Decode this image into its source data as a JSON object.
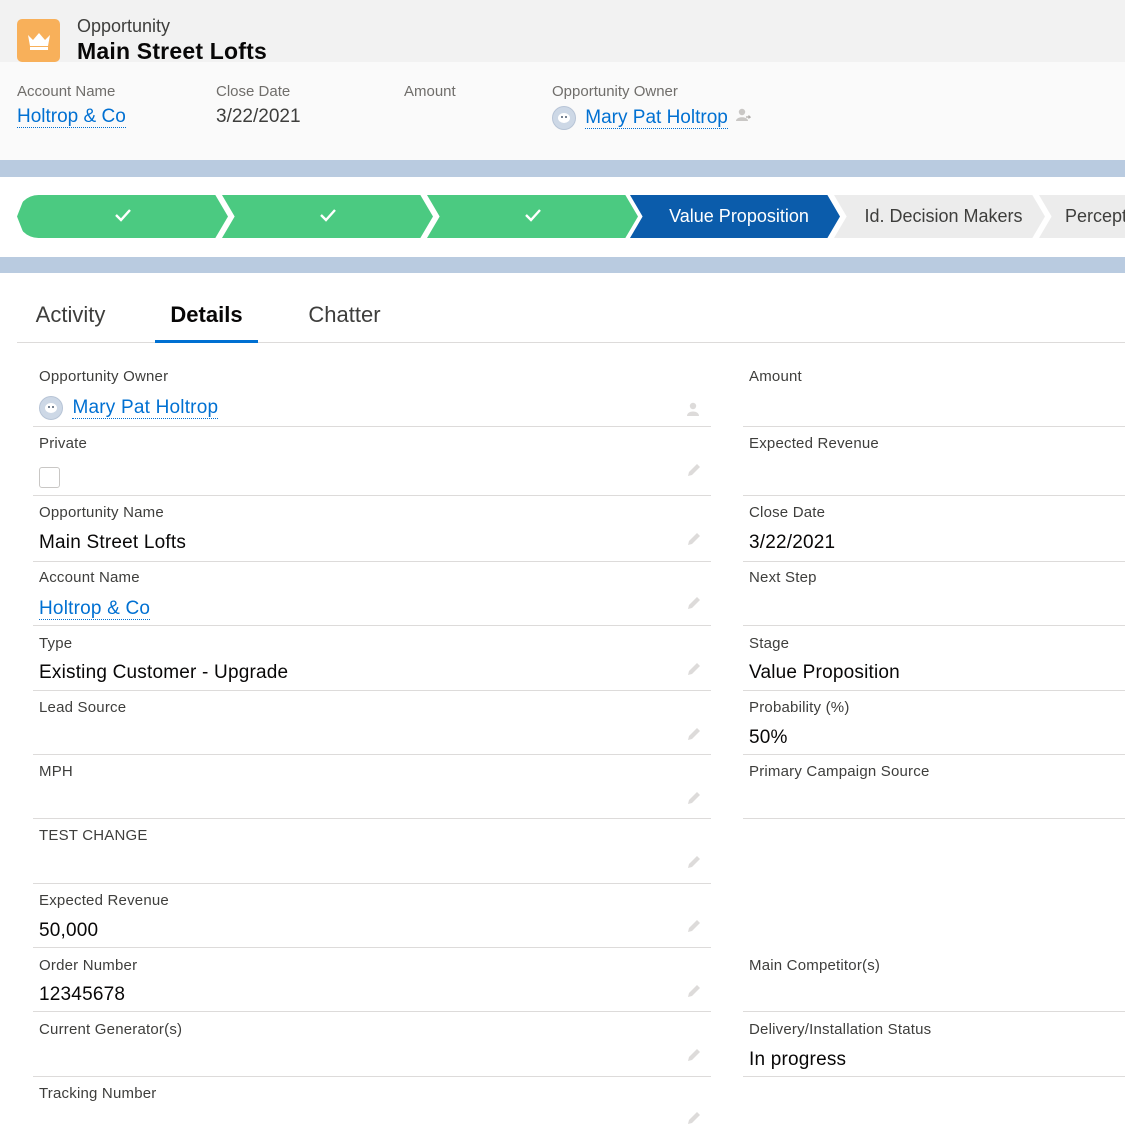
{
  "record": {
    "object_type": "Opportunity",
    "title": "Main Street Lofts",
    "icon": "crown-icon",
    "icon_color": "#f8b05a"
  },
  "highlights": [
    {
      "label": "Account Name",
      "value": "Holtrop & Co",
      "link": true
    },
    {
      "label": "Close Date",
      "value": "3/22/2021",
      "link": false
    },
    {
      "label": "Amount",
      "value": "",
      "link": false
    },
    {
      "label": "Opportunity Owner",
      "value": "Mary Pat Holtrop",
      "link": true
    }
  ],
  "path": {
    "stages": [
      {
        "label": "",
        "status": "complete",
        "icon": "check-icon"
      },
      {
        "label": "",
        "status": "complete",
        "icon": "check-icon"
      },
      {
        "label": "",
        "status": "complete",
        "icon": "check-icon"
      },
      {
        "label": "Value Proposition",
        "status": "current"
      },
      {
        "label": "Id. Decision Makers",
        "status": "incomplete"
      },
      {
        "label": "Percept",
        "status": "incomplete"
      }
    ],
    "complete_color": "#4bca81",
    "current_color": "#0b5cab"
  },
  "tabs": [
    {
      "label": "Activity",
      "active": false
    },
    {
      "label": "Details",
      "active": true
    },
    {
      "label": "Chatter",
      "active": false
    }
  ],
  "details": {
    "left": [
      {
        "label": "Opportunity Owner",
        "value": "Mary Pat Holtrop"
      },
      {
        "label": "Private",
        "value": ""
      },
      {
        "label": "Opportunity Name",
        "value": "Main Street Lofts"
      },
      {
        "label": "Account Name",
        "value": "Holtrop & Co"
      },
      {
        "label": "Type",
        "value": "Existing Customer - Upgrade"
      },
      {
        "label": "Lead Source",
        "value": ""
      },
      {
        "label": "MPH",
        "value": ""
      },
      {
        "label": "TEST CHANGE",
        "value": ""
      },
      {
        "label": "Expected Revenue",
        "value": "50,000"
      },
      {
        "label": "Order Number",
        "value": "12345678"
      },
      {
        "label": "Current Generator(s)",
        "value": ""
      },
      {
        "label": "Tracking Number",
        "value": ""
      }
    ],
    "right": [
      {
        "label": "Amount",
        "value": ""
      },
      {
        "label": "Expected Revenue",
        "value": ""
      },
      {
        "label": "Close Date",
        "value": "3/22/2021"
      },
      {
        "label": "Next Step",
        "value": ""
      },
      {
        "label": "Stage",
        "value": "Value Proposition"
      },
      {
        "label": "Probability (%)",
        "value": "50%"
      },
      {
        "label": "Primary Campaign Source",
        "value": ""
      },
      {
        "label": "Main Competitor(s)",
        "value": ""
      },
      {
        "label": "Delivery/Installation Status",
        "value": "In progress"
      }
    ],
    "private_checked": false
  },
  "colors": {
    "link": "#0070d2",
    "band": "#b9cbe0"
  }
}
